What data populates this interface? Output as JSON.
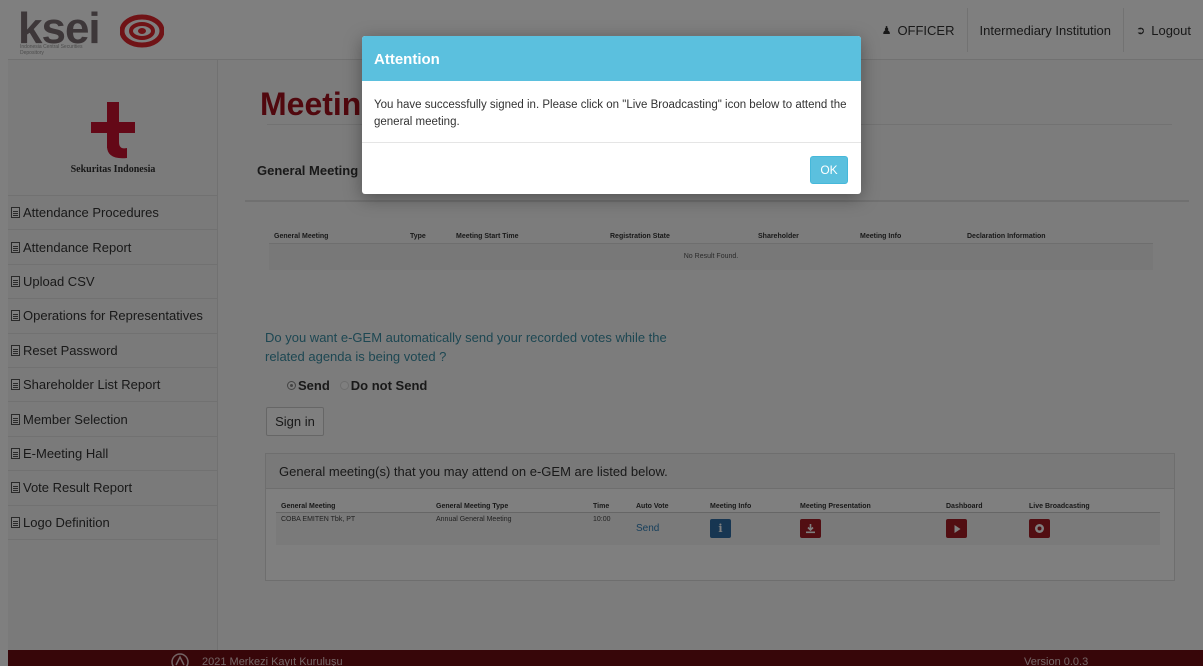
{
  "header": {
    "logo_text": "ksei",
    "logo_sub": "Indonesia Central Securities Depository",
    "user_label": "OFFICER",
    "institution_label": "Intermediary Institution",
    "logout_label": "Logout"
  },
  "sidebar": {
    "org_name": "Sekuritas Indonesia",
    "items": [
      {
        "label": "Attendance Procedures"
      },
      {
        "label": "Attendance Report"
      },
      {
        "label": "Upload CSV"
      },
      {
        "label": "Operations for Representatives"
      },
      {
        "label": "Reset Password"
      },
      {
        "label": "Shareholder List Report"
      },
      {
        "label": "Member Selection"
      },
      {
        "label": "E-Meeting Hall"
      },
      {
        "label": "Vote Result Report"
      },
      {
        "label": "Logo Definition"
      }
    ]
  },
  "main": {
    "page_title": "Meetings",
    "tab_label": "General Meeting",
    "table1": {
      "headers": [
        "General Meeting",
        "Type",
        "Meeting Start Time",
        "Registration State",
        "Shareholder",
        "Meeting Info",
        "Declaration Information"
      ],
      "empty_text": "No Result Found."
    },
    "question": "Do you want e-GEM automatically send your recorded votes while the related agenda is being voted ?",
    "radio_send": "Send",
    "radio_do_not_send": "Do not Send",
    "radio_selected": "Send",
    "signin_label": "Sign in",
    "panel_title": "General meeting(s) that you may attend on e-GEM are listed below.",
    "table2": {
      "headers": [
        "General Meeting",
        "General Meeting Type",
        "Time",
        "Auto Vote",
        "Meeting Info",
        "Meeting Presentation",
        "Dashboard",
        "Live Broadcasting"
      ],
      "rows": [
        {
          "general_meeting": "COBA EMITEN Tbk, PT",
          "type": "Annual General Meeting",
          "time": "10:00",
          "auto_vote": "Send",
          "meeting_info_icon": "info-icon",
          "presentation_icon": "download-icon",
          "dashboard_icon": "play-icon",
          "live_icon": "record-icon"
        }
      ]
    }
  },
  "footer": {
    "copyright": "2021 Merkezi Kayıt Kuruluşu",
    "version": "Version 0.0.3"
  },
  "modal": {
    "title": "Attention",
    "message": "You have successfully signed in. Please click on \"Live Broadcasting\" icon below to attend the general meeting.",
    "ok_label": "OK"
  },
  "colors": {
    "brand_red": "#a3101d",
    "footer_bg": "#6f0d12",
    "modal_header": "#5bc0de",
    "link_teal": "#3b8ea5",
    "info_blue": "#2e6da4",
    "action_red": "#a51d24"
  }
}
